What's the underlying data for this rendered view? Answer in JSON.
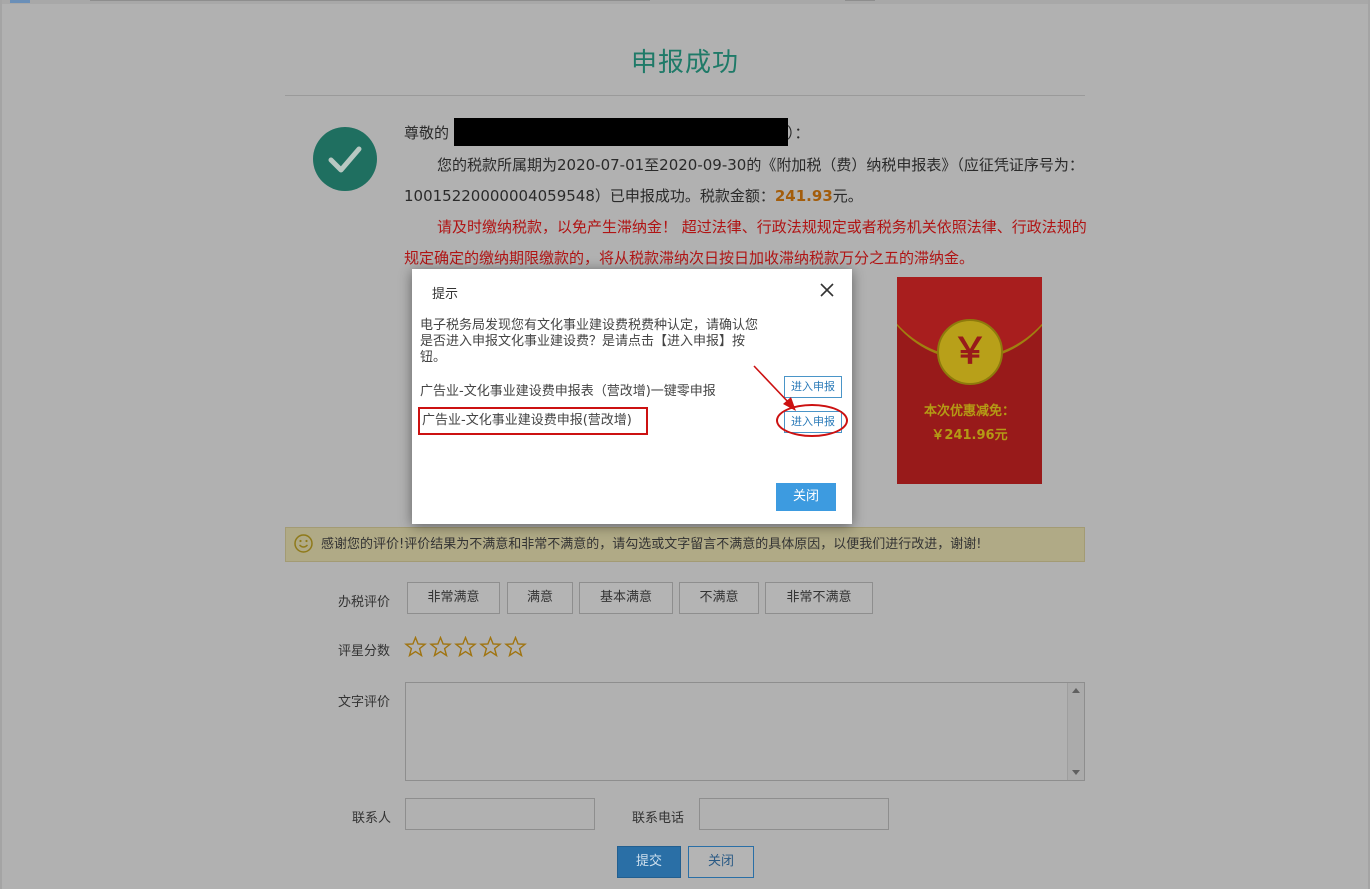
{
  "page": {
    "title": "申报成功"
  },
  "success": {
    "greeting_prefix": "尊敬的",
    "greeting_suffix": "）：",
    "message_before_amount": "您的税款所属期为2020-07-01至2020-09-30的《附加税（费）纳税申报表》（应征凭证序号为：10015220000004059548）已申报成功。税款金额：",
    "tax_amount": "241.93",
    "amount_unit": "元。",
    "warning": "请及时缴纳税款，以免产生滞纳金！ 超过法律、行政法规规定或者税务机关依照法律、行政法规的规定确定的缴纳期限缴款的，将从税款滞纳次日按日加收滞纳税款万分之五的滞纳金。"
  },
  "red_packet": {
    "symbol": "￥",
    "label": "本次优惠减免：",
    "amount": "￥241.96元"
  },
  "dialog": {
    "title": "提示",
    "message": "电子税务局发现您有文化事业建设费税费种认定，请确认您是否进入申报文化事业建设费？是请点击【进入申报】按钮。",
    "items": [
      {
        "label": "广告业-文化事业建设费申报表（营改增)一键零申报",
        "button": "进入申报"
      },
      {
        "label": "广告业-文化事业建设费申报(营改增)",
        "button": "进入申报"
      }
    ],
    "close_button": "关闭"
  },
  "feedback": {
    "notice": "感谢您的评价!评价结果为不满意和非常不满意的，请勾选或文字留言不满意的具体原因，以便我们进行改进，谢谢!",
    "rating_label": "办税评价",
    "rating_options": [
      "非常满意",
      "满意",
      "基本满意",
      "不满意",
      "非常不满意"
    ],
    "star_label": "评星分数",
    "star_count": 5,
    "text_label": "文字评价",
    "contact_label": "联系人",
    "phone_label": "联系电话",
    "submit_button": "提交",
    "close_button": "关闭"
  },
  "colors": {
    "title_green": "#1f7a68",
    "warning_red": "#b01414",
    "amount_orange": "#a35d0c",
    "primary_blue": "#3d9be0",
    "red_packet": "#981a1a"
  }
}
